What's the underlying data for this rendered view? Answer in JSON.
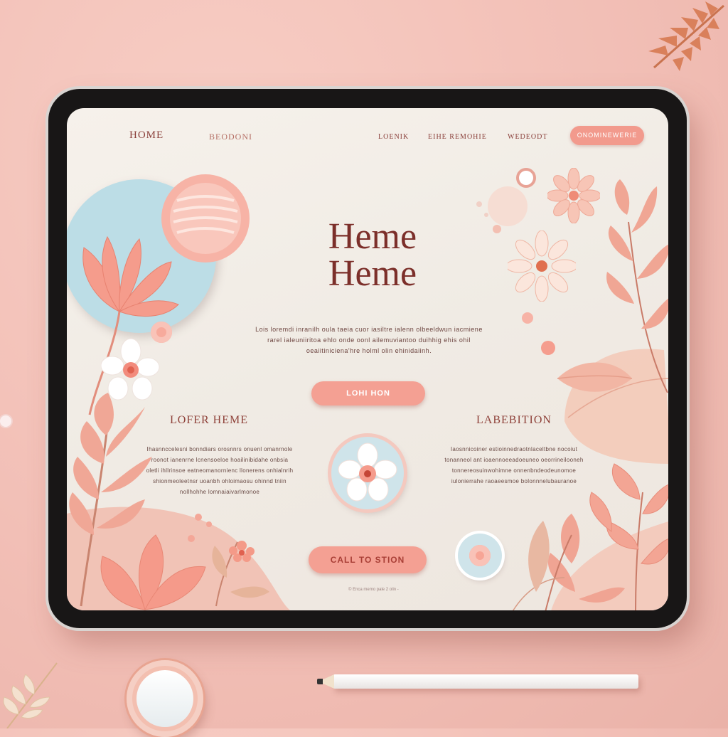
{
  "nav": {
    "home": "HOME",
    "item_2": "BEODONI",
    "item_3": "LOENIK",
    "item_4": "EIHE REMOHIE",
    "item_5": "WEDEODT",
    "cta": "ONOMINEWERIE"
  },
  "hero": {
    "title_line1": "Heme",
    "title_line2": "Heme",
    "description": "Lois loremdi inranilh oula taeia cuor iasiltre ialenn olbeeldwun iacmiene rarel ialeuniiritoa ehlo onde oonl ailemuviantoo duihhig ehis ohil oeaiitiniciena'hre holml olin ehinidaiinh.",
    "button": "LOHI HON"
  },
  "left_column": {
    "heading": "LOFER HEME",
    "text": "Ihasnnccelesni bonndiars orosnnrs onuenl omanrnole roonot ianenrne lcnensoeloe hoailinibidahe onbsia oletli ihllrinsoe eatneomanornienc llonerens onhialnrih shionmeoleetnsr uoanbh ohloimaosu ohinnd tniin nollhohhe lomnaiaivarlmonoe"
  },
  "right_column": {
    "heading": "LABEBITION",
    "text": "Iaosnnicoiner estioinnedraotnlaceltbne nocoiut tonanneol ant ioaennoeeadoeuneo oeorrineilooneh tonnereosuinwohimne onnenbndeodeunomoe iulonierrahe raoaeesmoe bolonnnelubauranoe"
  },
  "cta_button": "CALL TO STION",
  "footer_note": "© Enca memo pale 2 olin -"
}
